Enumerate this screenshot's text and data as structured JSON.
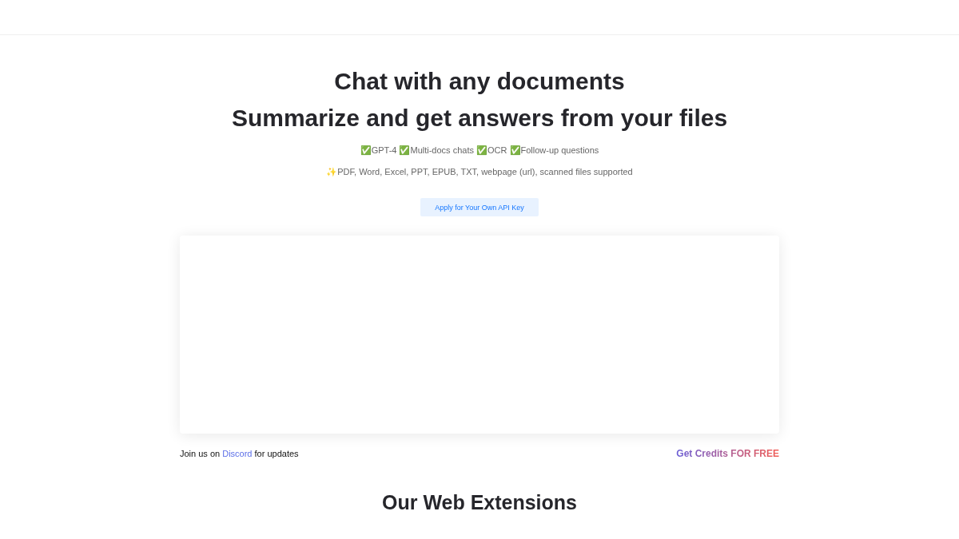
{
  "hero": {
    "titles": [
      "Chat with any documents",
      "Summarize and get answers from your files"
    ],
    "features": "✅GPT-4 ✅Multi-docs chats ✅OCR ✅Follow-up questions",
    "formats": "✨PDF, Word, Excel, PPT, EPUB, TXT, webpage (url), scanned files supported",
    "api_button": "Apply for Your Own API Key"
  },
  "footer_links": {
    "prefix": "Join us on ",
    "link": "Discord",
    "suffix": " for updates",
    "credits": "Get Credits FOR FREE"
  },
  "extensions": {
    "title": "Our Web Extensions"
  }
}
